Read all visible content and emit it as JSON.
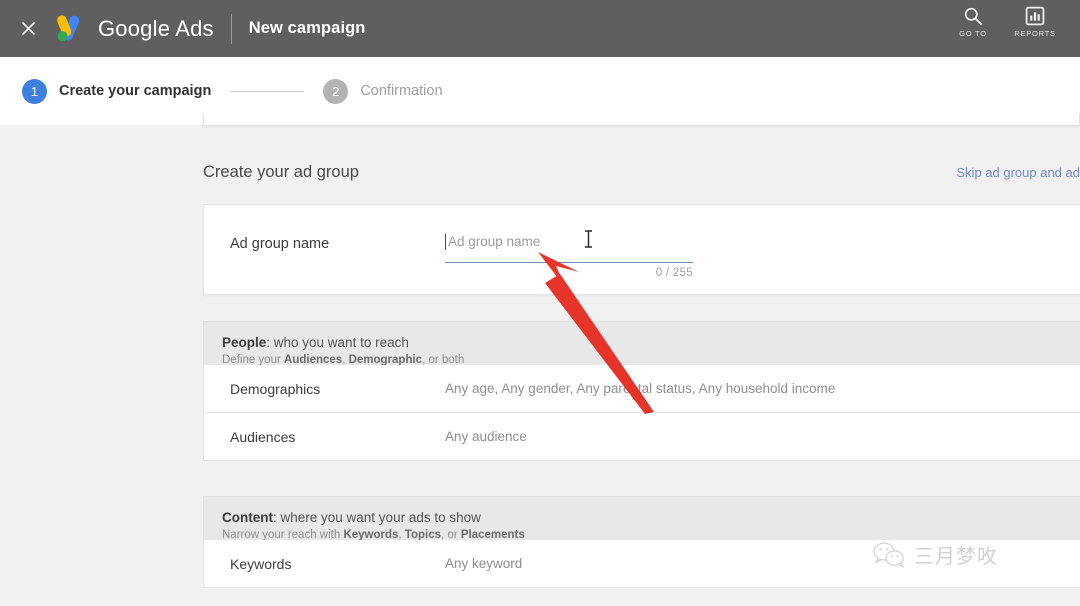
{
  "topbar": {
    "close_label": "×",
    "brand": "Google Ads",
    "page_title": "New campaign",
    "actions": [
      {
        "icon": "search-icon",
        "label": "GO TO"
      },
      {
        "icon": "bar-chart-icon",
        "label": "REPORTS"
      }
    ]
  },
  "stepper": {
    "steps": [
      {
        "num": "1",
        "label": "Create your campaign",
        "state": "active"
      },
      {
        "num": "2",
        "label": "Confirmation",
        "state": "inactive"
      }
    ]
  },
  "main": {
    "section_title": "Create your ad group",
    "skip_link": "Skip ad group and ad",
    "ad_group": {
      "label": "Ad group name",
      "placeholder": "Ad group name",
      "value": "",
      "counter": "0 / 255"
    },
    "groups": [
      {
        "id": "people",
        "head_strong": "People",
        "head_rest": ": who you want to reach",
        "sub_prefix": "Define your ",
        "sub_b1": "Audiences",
        "sub_mid": ", ",
        "sub_b2": "Demographic",
        "sub_suffix": ", or both",
        "rows": [
          {
            "label": "Demographics",
            "value": "Any age, Any gender, Any parental status, Any household income"
          },
          {
            "label": "Audiences",
            "value": "Any audience"
          }
        ]
      },
      {
        "id": "content",
        "head_strong": "Content",
        "head_rest": ": where you want your ads to show",
        "sub_prefix": "Narrow your reach with ",
        "sub_b1": "Keywords",
        "sub_mid": ", ",
        "sub_b2": "Topics",
        "sub_suffix": ", or ",
        "sub_b3": "Placements",
        "rows": [
          {
            "label": "Keywords",
            "value": "Any keyword"
          }
        ]
      }
    ]
  },
  "annotation": {
    "arrow_color": "#e8342a",
    "arrow_tip": "540,252",
    "arrow_tail": "652,410"
  },
  "watermark": {
    "icon": "wechat-icon",
    "text": "三月梦呚"
  },
  "colors": {
    "topbar": "#5f5f5f",
    "accent_blue": "#3e7fe0",
    "link_blue": "#7089c4",
    "page_bg": "#f1f1f1",
    "card_bg": "#ffffff",
    "group_head_bg": "#e8e8e8"
  }
}
